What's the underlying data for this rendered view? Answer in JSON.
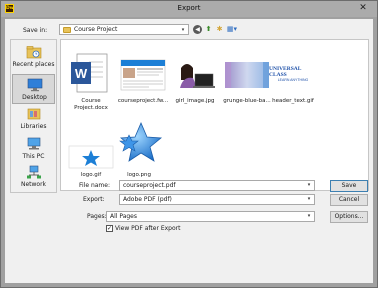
{
  "window": {
    "title": "Export",
    "app_badge": "Dw",
    "close_glyph": "✕"
  },
  "toolbar": {
    "save_in_label": "Save in:",
    "save_in_value": "Course Project",
    "icons": [
      "back-icon",
      "up-folder-icon",
      "new-folder-icon",
      "view-menu-icon"
    ]
  },
  "places": [
    {
      "label": "Recent places",
      "icon": "recent-places-icon"
    },
    {
      "label": "Desktop",
      "icon": "desktop-icon",
      "selected": true
    },
    {
      "label": "Libraries",
      "icon": "libraries-icon"
    },
    {
      "label": "This PC",
      "icon": "computer-icon"
    },
    {
      "label": "Network",
      "icon": "network-icon"
    }
  ],
  "files": [
    {
      "name": "Course\nProject.docx",
      "kind": "word"
    },
    {
      "name": "courseproject.fw...",
      "kind": "doc-thumb"
    },
    {
      "name": "girl_image.jpg",
      "kind": "photo"
    },
    {
      "name": "grunge-blue-ba...",
      "kind": "grunge"
    },
    {
      "name": "header_text.gif",
      "kind": "header"
    },
    {
      "name": "logo.gif",
      "kind": "logo-small"
    },
    {
      "name": "logo.png",
      "kind": "logo-big"
    }
  ],
  "header_text_thumb": {
    "line1": "UNIVERSAL CLASS",
    "line2": "LEARN ANYTHING"
  },
  "form": {
    "file_name_label": "File name:",
    "file_name_value": "courseproject.pdf",
    "export_label": "Export:",
    "export_value": "Adobe PDF (pdf)",
    "pages_label": "Pages:",
    "pages_value": "All Pages",
    "view_pdf_label": "View PDF after Export",
    "view_pdf_checked": "✓"
  },
  "buttons": {
    "save": "Save",
    "cancel": "Cancel",
    "options": "Options..."
  },
  "colors": {
    "accent": "#2c6bc0",
    "word_blue": "#2b579a",
    "star_blue": "#1c7fd6"
  }
}
